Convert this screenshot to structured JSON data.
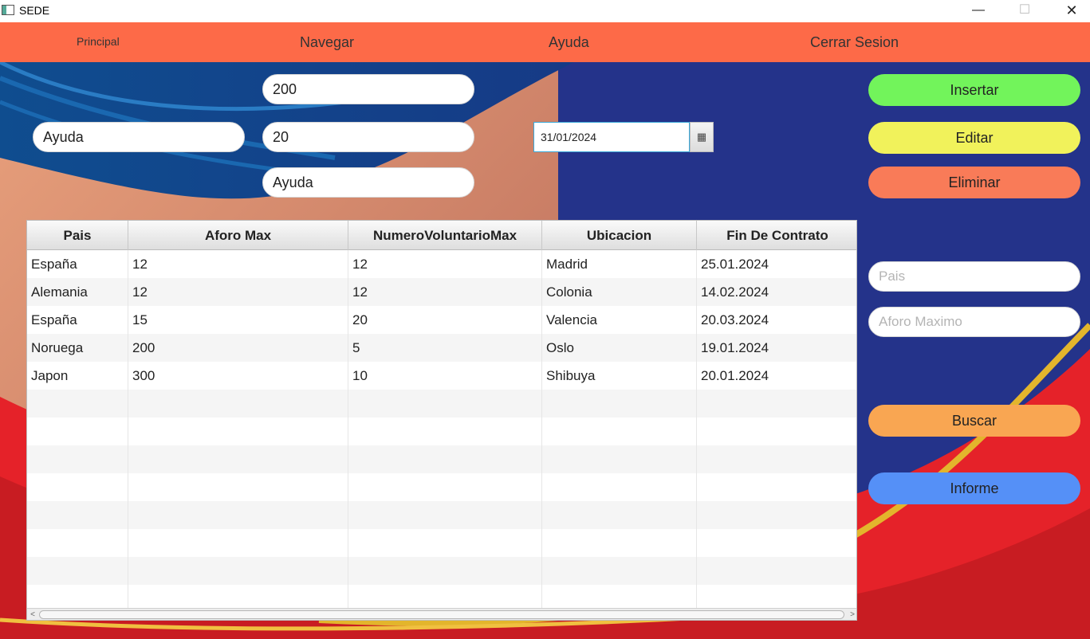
{
  "window": {
    "title": "SEDE",
    "minimize": "—",
    "maximize": "☐",
    "close": "✕"
  },
  "menu": {
    "principal": "Principal",
    "navegar": "Navegar",
    "ayuda": "Ayuda",
    "cerrar_sesion": "Cerrar Sesion"
  },
  "form": {
    "field_left": "Ayuda",
    "field_aforo": "200",
    "field_voluntarios": "20",
    "field_ubicacion": "Ayuda",
    "date_value": "31/01/2024",
    "calendar_icon": "▦"
  },
  "buttons": {
    "insertar": "Insertar",
    "editar": "Editar",
    "eliminar": "Eliminar",
    "buscar": "Buscar",
    "informe": "Informe"
  },
  "search": {
    "pais_placeholder": "Pais",
    "aforo_placeholder": "Aforo Maximo"
  },
  "table": {
    "columns": [
      "Pais",
      "Aforo Max",
      "NumeroVoluntarioMax",
      "Ubicacion",
      "Fin De Contrato"
    ],
    "rows": [
      [
        "España",
        "12",
        "12",
        "Madrid",
        "25.01.2024"
      ],
      [
        "Alemania",
        "12",
        "12",
        "Colonia",
        "14.02.2024"
      ],
      [
        "España",
        "15",
        "20",
        "Valencia",
        "20.03.2024"
      ],
      [
        "Noruega",
        "200",
        "5",
        "Oslo",
        "19.01.2024"
      ],
      [
        "Japon",
        "300",
        "10",
        "Shibuya",
        "20.01.2024"
      ],
      [
        "",
        "",
        "",
        "",
        ""
      ],
      [
        "",
        "",
        "",
        "",
        ""
      ],
      [
        "",
        "",
        "",
        "",
        ""
      ],
      [
        "",
        "",
        "",
        "",
        ""
      ],
      [
        "",
        "",
        "",
        "",
        ""
      ],
      [
        "",
        "",
        "",
        "",
        ""
      ],
      [
        "",
        "",
        "",
        "",
        ""
      ],
      [
        "",
        "",
        "",
        "",
        ""
      ]
    ],
    "scroll_left": "<",
    "scroll_right": ">"
  },
  "colors": {
    "menubar": "#fd6a48",
    "insertar": "#72f45b",
    "editar": "#f1f25b",
    "eliminar": "#f97b58",
    "buscar": "#f9a652",
    "informe": "#5590f7"
  }
}
